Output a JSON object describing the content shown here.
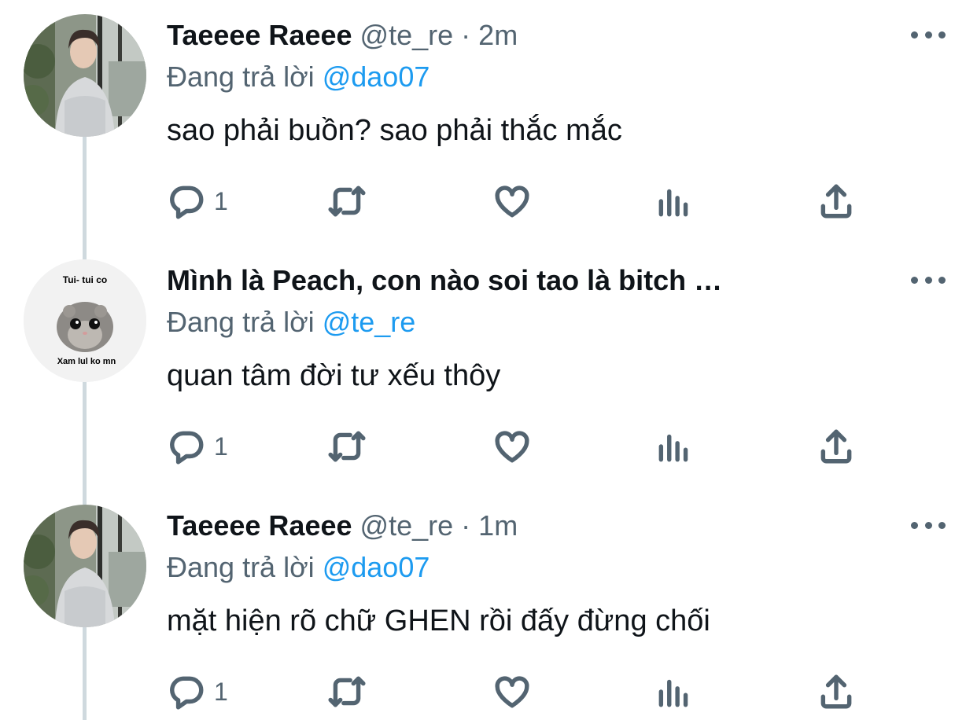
{
  "tweets": [
    {
      "name": "Taeeee Raeee",
      "handle": "@te_re",
      "separator": "·",
      "time": "2m",
      "reply_prefix": "Đang trả lời",
      "reply_to": "@dao07",
      "text": "sao phải buồn? sao phải thắc mắc",
      "reply_count": "1",
      "avatar": "person-photo"
    },
    {
      "name": "Mình là Peach, con nào soi tao là bitch …",
      "handle": "",
      "separator": "",
      "time": "",
      "reply_prefix": "Đang trả lời",
      "reply_to": "@te_re",
      "text": "quan tâm đời tư xếu thôy",
      "reply_count": "1",
      "avatar": "hamster-meme",
      "avatar_text_top": "Tui- tui co",
      "avatar_text_bottom": "Xam lul ko mn"
    },
    {
      "name": "Taeeee Raeee",
      "handle": "@te_re",
      "separator": "·",
      "time": "1m",
      "reply_prefix": "Đang trả lời",
      "reply_to": "@dao07",
      "text": "mặt hiện rõ chữ GHEN rồi đấy đừng chối",
      "reply_count": "1",
      "avatar": "person-photo"
    }
  ],
  "colors": {
    "text": "#0f1419",
    "muted": "#536471",
    "link": "#1d9bf0",
    "thread_line": "#cfd9de"
  },
  "icons": [
    "reply-icon",
    "retweet-icon",
    "like-icon",
    "analytics-icon",
    "share-icon",
    "more-icon"
  ]
}
